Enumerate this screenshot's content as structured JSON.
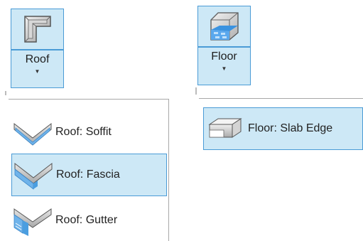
{
  "roof_button": {
    "label": "Roof",
    "icon": "roof-icon",
    "menu": [
      {
        "label": "Roof: Soffit",
        "icon": "soffit-icon",
        "highlighted": false
      },
      {
        "label": "Roof: Fascia",
        "icon": "fascia-icon",
        "highlighted": true
      },
      {
        "label": "Roof: Gutter",
        "icon": "gutter-icon",
        "highlighted": false
      }
    ]
  },
  "floor_button": {
    "label": "Floor",
    "icon": "floor-icon",
    "menu": [
      {
        "label": "Floor: Slab Edge",
        "icon": "slab-edge-icon",
        "highlighted": true
      }
    ]
  },
  "colors": {
    "highlight_fill": "#cde8f6",
    "highlight_border": "#4a9bd6"
  }
}
